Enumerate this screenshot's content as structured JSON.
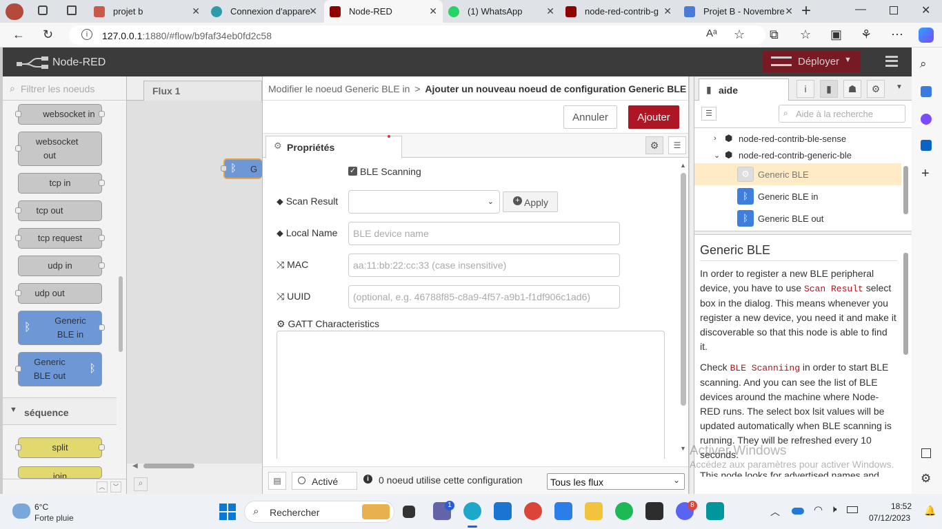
{
  "browser": {
    "tabs": [
      {
        "label": "projet b",
        "color": "#c85a4a"
      },
      {
        "label": "Connexion d'appare",
        "color": "#2e9ca8"
      },
      {
        "label": "Node-RED",
        "color": "#8f0000",
        "active": true
      },
      {
        "label": "(1) WhatsApp",
        "color": "#25d366"
      },
      {
        "label": "node-red-contrib-g",
        "color": "#8f0000"
      },
      {
        "label": "Projet B - Novembre",
        "color": "#4a7bd6"
      }
    ],
    "url_host": "127.0.0.1",
    "url_rest": ":1880/#flow/b9faf34eb0fd2c58"
  },
  "nr": {
    "title": "Node-RED",
    "deploy": "Déployer",
    "palette_filter_placeholder": "Filtrer les noeuds",
    "palette_nodes": [
      {
        "label": "websocket in",
        "color": "#c7c7c7"
      },
      {
        "label": "websocket out",
        "color": "#c7c7c7"
      },
      {
        "label": "tcp in",
        "color": "#c7c7c7"
      },
      {
        "label": "tcp out",
        "color": "#c7c7c7"
      },
      {
        "label": "tcp request",
        "color": "#c7c7c7"
      },
      {
        "label": "udp in",
        "color": "#c7c7c7"
      },
      {
        "label": "udp out",
        "color": "#c7c7c7"
      },
      {
        "label": "Generic BLE in",
        "color": "#6e97d6"
      },
      {
        "label": "Generic BLE out",
        "color": "#6e97d6"
      },
      {
        "label": "split",
        "color": "#e2d96e"
      },
      {
        "label": "join",
        "color": "#e2d96e"
      }
    ],
    "category_sequence": "séquence",
    "workspace_tab": "Flux 1",
    "workspace_node_letter": "G"
  },
  "dialog": {
    "breadcrumb_parent": "Modifier le noeud Generic BLE in",
    "breadcrumb_sep": ">",
    "breadcrumb_current": "Ajouter un nouveau noeud de configuration Generic BLE",
    "cancel": "Annuler",
    "add": "Ajouter",
    "tab_properties": "Propriétés",
    "ble_scanning_label": "BLE Scanning",
    "ble_scanning_checked": true,
    "scan_result_label": "Scan Result",
    "apply": "Apply",
    "local_name_label": "Local Name",
    "local_name_placeholder": "BLE device name",
    "mac_label": "MAC",
    "mac_placeholder": "aa:11:bb:22:cc:33 (case insensitive)",
    "uuid_label": "UUID",
    "uuid_placeholder": "(optional, e.g. 46788f85-c8a9-4f57-a9b1-f1df906c1ad6)",
    "gatt_label": "GATT Characteristics",
    "active_label": "Activé",
    "usage": "0 noeud utilise cette configuration",
    "scope": "Tous les flux"
  },
  "help": {
    "tab": "aide",
    "search_placeholder": "Aide à la recherche",
    "tree": [
      {
        "label": "node-red-contrib-ble-sense"
      },
      {
        "label": "node-red-contrib-generic-ble"
      },
      {
        "label": "Generic BLE"
      },
      {
        "label": "Generic BLE in"
      },
      {
        "label": "Generic BLE out"
      }
    ],
    "title": "Generic BLE",
    "p1_a": "In order to register a new BLE peripheral device, you have to use ",
    "p1_code": "Scan Result",
    "p1_b": " select box in the dialog. This means whenever you register a new device, you need it and make it discoverable so that this node is able to find it.",
    "p2_a": "Check ",
    "p2_code": "BLE Scanniing",
    "p2_b": " in order to start BLE scanning. And you can see the list of BLE devices around the machine where Node-RED runs. The select box lsit values will be updated automatically when BLE scanning is running. They will be refreshed every 10 seconds.",
    "p3": "This node looks for advertised names and"
  },
  "windows": {
    "watermark_title": "Activer Windows",
    "watermark_sub": "Accédez aux paramètres pour activer Windows.",
    "weather_temp": "6°C",
    "weather_desc": "Forte pluie",
    "search": "Rechercher",
    "time": "18:52",
    "date": "07/12/2023",
    "badge_teams": "1",
    "badge_discord": "8"
  }
}
